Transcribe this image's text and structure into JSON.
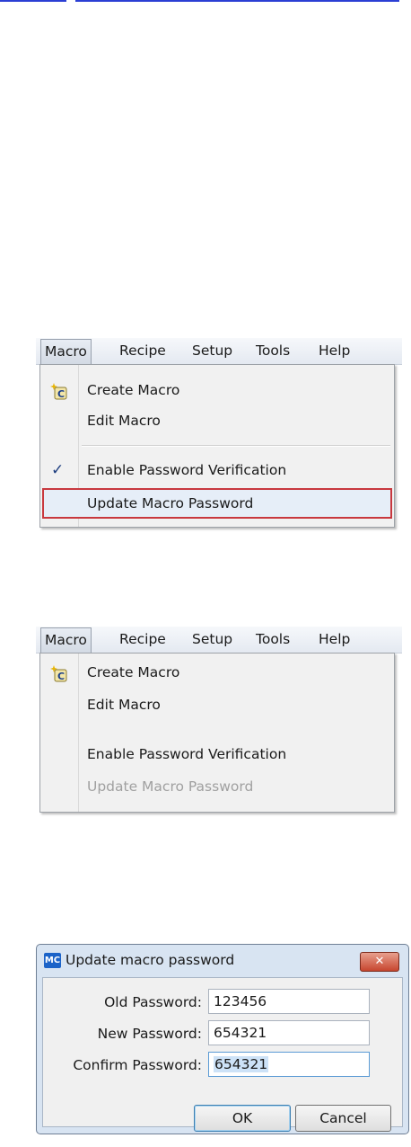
{
  "menu_bar": [
    "Macro",
    "Recipe",
    "Setup",
    "Tools",
    "Help"
  ],
  "menu1": {
    "items": {
      "create": "Create Macro",
      "edit": "Edit Macro",
      "enable": "Enable Password Verification",
      "update": "Update Macro Password"
    },
    "enable_checked": true,
    "update_highlighted": true
  },
  "menu2": {
    "items": {
      "create": "Create Macro",
      "edit": "Edit Macro",
      "enable": "Enable Password Verification",
      "update": "Update Macro Password"
    },
    "enable_checked": false,
    "update_disabled": true
  },
  "icons": {
    "macro_item": "create-macro-icon",
    "check": "checkmark-icon",
    "title": "mc-app-icon",
    "close": "close-icon"
  },
  "colors": {
    "highlight_border": "#c8383e",
    "title_icon": "#1c63c8",
    "close_button": "#c7462f"
  },
  "dialog": {
    "icon_text": "MC",
    "title": "Update macro password",
    "close_glyph": "✕",
    "fields": {
      "old": {
        "label": "Old Password:",
        "value": "123456"
      },
      "new": {
        "label": "New Password:",
        "value": "654321"
      },
      "confirm": {
        "label": "Confirm Password:",
        "value": "654321"
      }
    },
    "ok_label": "OK",
    "cancel_label": "Cancel"
  }
}
